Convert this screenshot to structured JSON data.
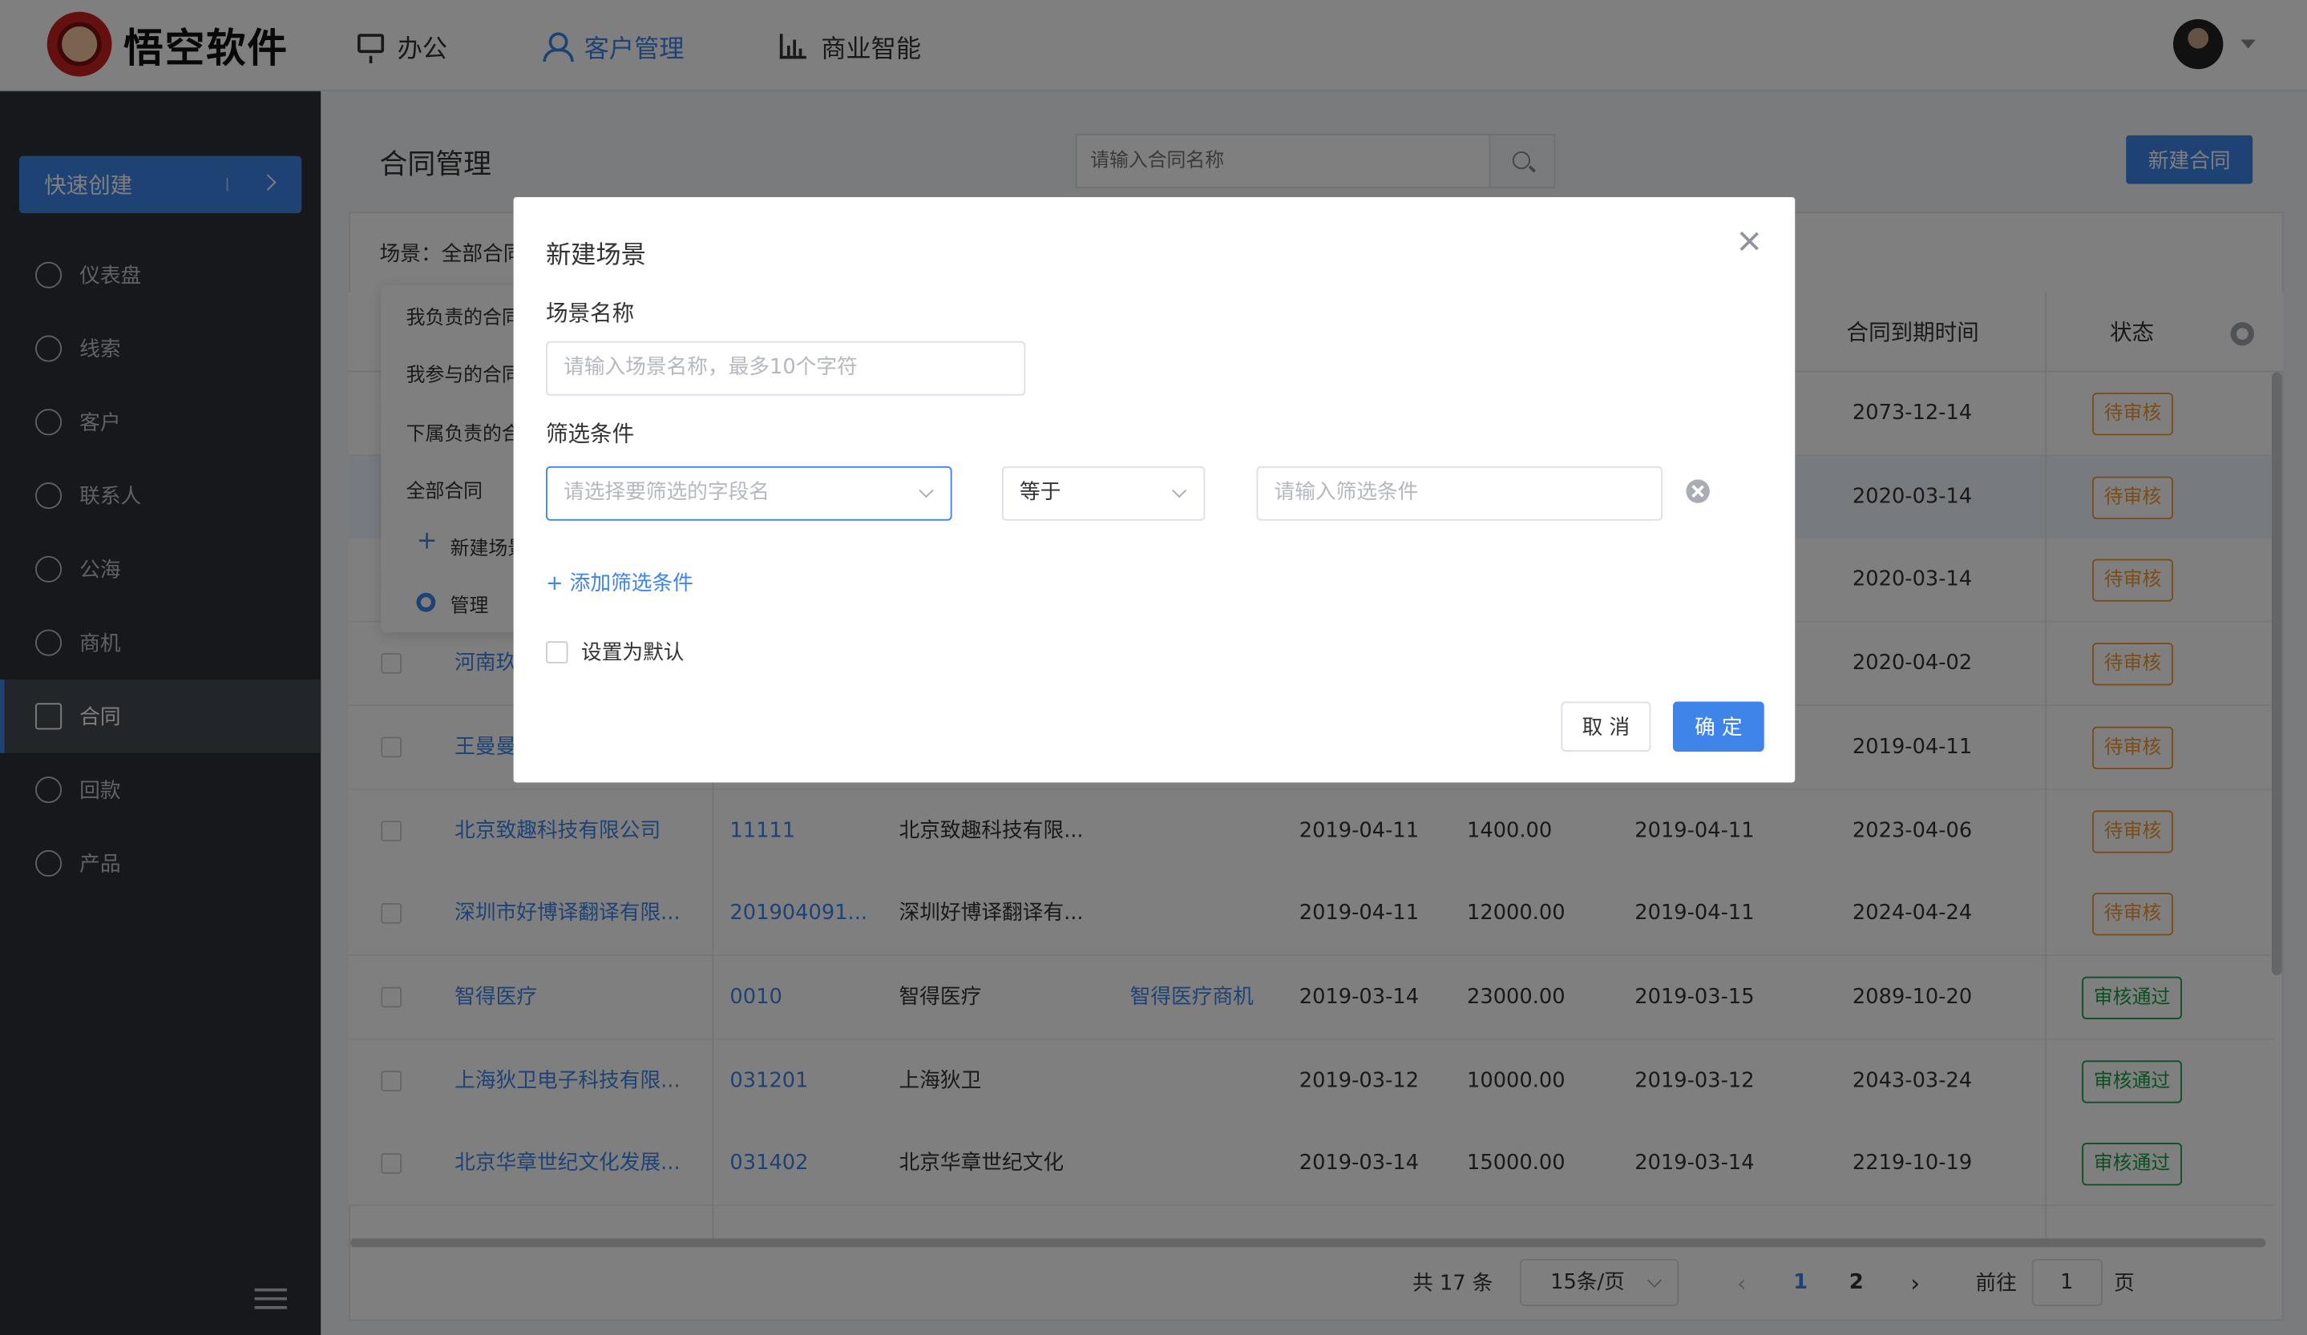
{
  "header": {
    "brand": "悟空软件",
    "nav": [
      {
        "label": "办公",
        "icon": "monitor-icon",
        "active": false
      },
      {
        "label": "客户管理",
        "icon": "user-icon",
        "active": true
      },
      {
        "label": "商业智能",
        "icon": "bar-chart-icon",
        "active": false
      }
    ]
  },
  "sidebar": {
    "quick_create": "快速创建",
    "items": [
      {
        "label": "仪表盘",
        "icon": "dashboard-icon"
      },
      {
        "label": "线索",
        "icon": "clue-icon"
      },
      {
        "label": "客户",
        "icon": "customer-icon"
      },
      {
        "label": "联系人",
        "icon": "contact-icon"
      },
      {
        "label": "公海",
        "icon": "pool-icon"
      },
      {
        "label": "商机",
        "icon": "bulb-icon"
      },
      {
        "label": "合同",
        "icon": "contract-icon",
        "active": true
      },
      {
        "label": "回款",
        "icon": "payment-icon"
      },
      {
        "label": "产品",
        "icon": "product-icon"
      }
    ]
  },
  "page": {
    "title": "合同管理",
    "search_placeholder": "请输入合同名称",
    "new_button": "新建合同",
    "scene_label": "场景：全部合同"
  },
  "scene_dropdown": {
    "items": [
      "我负责的合同",
      "我参与的合同",
      "下属负责的合同",
      "全部合同"
    ],
    "new_scene": "新建场景",
    "manage": "管理"
  },
  "table": {
    "headers": {
      "end_date": "合同到期时间",
      "status": "状态"
    },
    "rows": [
      {
        "customer": "",
        "num": "",
        "name": "",
        "opp": "",
        "order_date": "",
        "amount": "",
        "start": "",
        "end": "2073-12-14",
        "status": "待审核",
        "status_type": "pending",
        "selected": false
      },
      {
        "customer": "",
        "num": "",
        "name": "",
        "opp": "",
        "order_date": "",
        "amount": "",
        "start": "",
        "end": "2020-03-14",
        "status": "待审核",
        "status_type": "pending",
        "selected": true
      },
      {
        "customer": "",
        "num": "",
        "name": "",
        "opp": "",
        "order_date": "",
        "amount": "",
        "start": "",
        "end": "2020-03-14",
        "status": "待审核",
        "status_type": "pending",
        "selected": false
      },
      {
        "customer": "河南玖",
        "num": "",
        "name": "",
        "opp": "",
        "order_date": "",
        "amount": "",
        "start": "",
        "end": "2020-04-02",
        "status": "待审核",
        "status_type": "pending",
        "selected": false
      },
      {
        "customer": "王曼曼",
        "num": "",
        "name": "",
        "opp": "",
        "order_date": "",
        "amount": "",
        "start": "",
        "end": "2019-04-11",
        "status": "待审核",
        "status_type": "pending",
        "selected": false
      },
      {
        "customer": "北京致趣科技有限公司",
        "num": "11111",
        "name": "北京致趣科技有限...",
        "opp": "",
        "order_date": "2019-04-11",
        "amount": "1400.00",
        "start": "2019-04-11",
        "end": "2023-04-06",
        "status": "待审核",
        "status_type": "pending",
        "selected": false
      },
      {
        "customer": "深圳市好博译翻译有限...",
        "num": "201904091...",
        "name": "深圳好博译翻译有...",
        "opp": "",
        "order_date": "2019-04-11",
        "amount": "12000.00",
        "start": "2019-04-11",
        "end": "2024-04-24",
        "status": "待审核",
        "status_type": "pending",
        "selected": false
      },
      {
        "customer": "智得医疗",
        "num": "0010",
        "name": "智得医疗",
        "opp": "智得医疗商机",
        "order_date": "2019-03-14",
        "amount": "23000.00",
        "start": "2019-03-15",
        "end": "2089-10-20",
        "status": "审核通过",
        "status_type": "pass",
        "selected": false
      },
      {
        "customer": "上海狄卫电子科技有限...",
        "num": "031201",
        "name": "上海狄卫",
        "opp": "",
        "order_date": "2019-03-12",
        "amount": "10000.00",
        "start": "2019-03-12",
        "end": "2043-03-24",
        "status": "审核通过",
        "status_type": "pass",
        "selected": false
      },
      {
        "customer": "北京华章世纪文化发展...",
        "num": "031402",
        "name": "北京华章世纪文化",
        "opp": "",
        "order_date": "2019-03-14",
        "amount": "15000.00",
        "start": "2019-03-14",
        "end": "2219-10-19",
        "status": "审核通过",
        "status_type": "pass",
        "selected": false
      }
    ]
  },
  "pagination": {
    "total": "共 17 条",
    "page_size": "15条/页",
    "pages": [
      "1",
      "2"
    ],
    "current": "1",
    "goto_label": "前往",
    "goto_value": "1",
    "page_suffix": "页"
  },
  "modal": {
    "title": "新建场景",
    "name_label": "场景名称",
    "name_placeholder": "请输入场景名称，最多10个字符",
    "filter_label": "筛选条件",
    "field_placeholder": "请选择要筛选的字段名",
    "operator": "等于",
    "value_placeholder": "请输入筛选条件",
    "add_filter": "+ 添加筛选条件",
    "default_label": "设置为默认",
    "cancel": "取 消",
    "confirm": "确 定"
  },
  "colors": {
    "accent": "#3e84e9",
    "sidebar": "#2d3037",
    "pending": "#f49a30",
    "pass": "#15a045"
  }
}
